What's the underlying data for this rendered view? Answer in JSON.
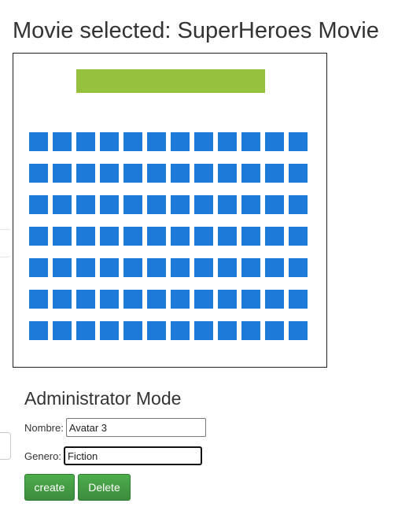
{
  "header": {
    "title": "Movie selected: SuperHeroes Movie"
  },
  "theater": {
    "screen_color": "#95c13f",
    "seat_color": "#1e7ad9",
    "rows": 7,
    "seats_per_row": 12
  },
  "admin": {
    "title": "Administrator Mode",
    "nombre_label": "Nombre:",
    "nombre_value": "Avatar 3",
    "genero_label": "Genero:",
    "genero_value": "Fiction",
    "create_label": "create",
    "delete_label": "Delete",
    "button_color": "#43a047"
  }
}
